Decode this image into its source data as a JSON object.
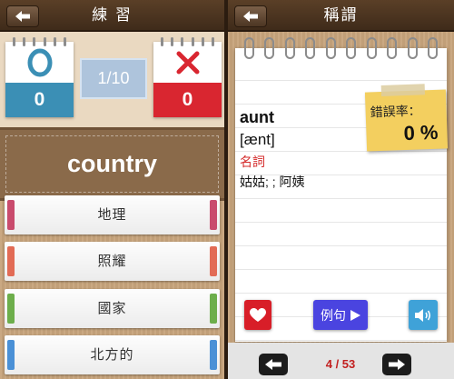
{
  "practice": {
    "title": "練 習",
    "correct_count": "0",
    "wrong_count": "0",
    "progress": "1/10",
    "word": "country",
    "options": [
      {
        "label": "地理",
        "color": "#c94b6d"
      },
      {
        "label": "照耀",
        "color": "#e26b55"
      },
      {
        "label": "國家",
        "color": "#6dae4b"
      },
      {
        "label": "北方的",
        "color": "#4a90d6"
      }
    ]
  },
  "vocab": {
    "title": "稱謂",
    "word": "aunt",
    "phonetic": "[ænt]",
    "pos": "名詞",
    "definition": "姑姑; ; 阿姨",
    "error_rate_label": "錯誤率：",
    "error_rate_value": "0 %",
    "example_label": "例句",
    "page_indicator": "4 / 53",
    "colors": {
      "pos": "#d42a2a",
      "favorite": "#d81e28",
      "example": "#4a44e0",
      "audio": "#3fa2d8",
      "page": "#c22020"
    }
  },
  "icons": [
    "back-arrow-icon",
    "circle-correct-icon",
    "x-wrong-icon",
    "heart-icon",
    "play-icon",
    "speaker-icon",
    "left-arrow-icon",
    "right-arrow-icon"
  ]
}
